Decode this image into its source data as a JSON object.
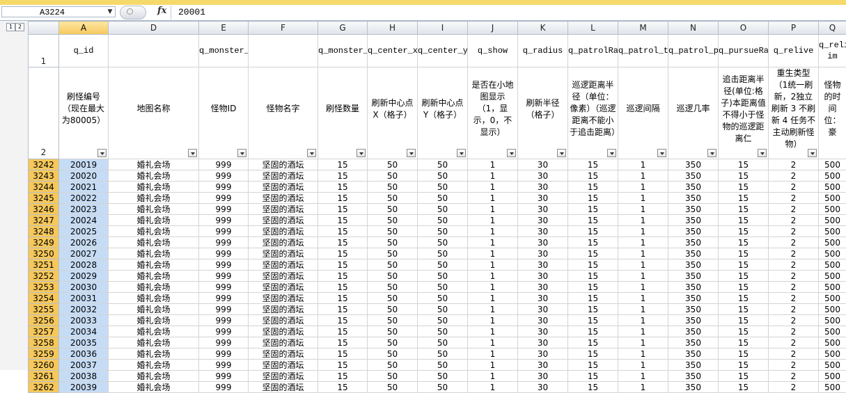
{
  "formula_bar": {
    "name_box": "A3224",
    "fx_label": "fx",
    "value": "20001"
  },
  "outline_levels": [
    "1",
    "2"
  ],
  "columns": [
    {
      "letter": "A",
      "field": "q_id",
      "desc": "刷怪编号（现在最大为80005）"
    },
    {
      "letter": "D",
      "field": "",
      "desc": "地图名称"
    },
    {
      "letter": "E",
      "field": "q_monster_model",
      "desc": "怪物ID"
    },
    {
      "letter": "F",
      "field": "",
      "desc": "怪物名字"
    },
    {
      "letter": "G",
      "field": "q_monster_num",
      "desc": "刷怪数量"
    },
    {
      "letter": "H",
      "field": "q_center_x",
      "desc": "刷新中心点X（格子）"
    },
    {
      "letter": "I",
      "field": "q_center_y",
      "desc": "刷新中心点Y（格子）"
    },
    {
      "letter": "J",
      "field": "q_show",
      "desc": "是否在小地图显示（1，显示，0，不显示）"
    },
    {
      "letter": "K",
      "field": "q_radius",
      "desc": "刷新半径（格子）"
    },
    {
      "letter": "L",
      "field": "q_patrolRange",
      "desc": "巡逻距离半径（单位：像素）（巡逻距离不能小于追击距离）"
    },
    {
      "letter": "M",
      "field": "q_patrol_time",
      "desc": "巡逻间隔"
    },
    {
      "letter": "N",
      "field": "q_patrol_pro",
      "desc": "巡逻几率"
    },
    {
      "letter": "O",
      "field": "q_pursueRange",
      "desc": "追击距离半径(单位:格子)本距离值不得小于怪物的巡逻距离仁"
    },
    {
      "letter": "P",
      "field": "q_relive",
      "desc": "重生类型（1统一刷新，2独立刷新 3 不刷新 4 任务不主动刷新怪物）"
    },
    {
      "letter": "Q",
      "field": "q_reli im",
      "desc": "怪物的时间位：豪"
    }
  ],
  "row_labels": {
    "header1": "1",
    "header2": "2"
  },
  "rows": [
    {
      "num": "3242",
      "cells": [
        "20019",
        "婚礼会场",
        "999",
        "坚固的酒坛",
        "15",
        "50",
        "50",
        "1",
        "30",
        "15",
        "1",
        "350",
        "15",
        "2",
        "500"
      ]
    },
    {
      "num": "3243",
      "cells": [
        "20020",
        "婚礼会场",
        "999",
        "坚固的酒坛",
        "15",
        "50",
        "50",
        "1",
        "30",
        "15",
        "1",
        "350",
        "15",
        "2",
        "500"
      ]
    },
    {
      "num": "3244",
      "cells": [
        "20021",
        "婚礼会场",
        "999",
        "坚固的酒坛",
        "15",
        "50",
        "50",
        "1",
        "30",
        "15",
        "1",
        "350",
        "15",
        "2",
        "500"
      ]
    },
    {
      "num": "3245",
      "cells": [
        "20022",
        "婚礼会场",
        "999",
        "坚固的酒坛",
        "15",
        "50",
        "50",
        "1",
        "30",
        "15",
        "1",
        "350",
        "15",
        "2",
        "500"
      ]
    },
    {
      "num": "3246",
      "cells": [
        "20023",
        "婚礼会场",
        "999",
        "坚固的酒坛",
        "15",
        "50",
        "50",
        "1",
        "30",
        "15",
        "1",
        "350",
        "15",
        "2",
        "500"
      ]
    },
    {
      "num": "3247",
      "cells": [
        "20024",
        "婚礼会场",
        "999",
        "坚固的酒坛",
        "15",
        "50",
        "50",
        "1",
        "30",
        "15",
        "1",
        "350",
        "15",
        "2",
        "500"
      ]
    },
    {
      "num": "3248",
      "cells": [
        "20025",
        "婚礼会场",
        "999",
        "坚固的酒坛",
        "15",
        "50",
        "50",
        "1",
        "30",
        "15",
        "1",
        "350",
        "15",
        "2",
        "500"
      ]
    },
    {
      "num": "3249",
      "cells": [
        "20026",
        "婚礼会场",
        "999",
        "坚固的酒坛",
        "15",
        "50",
        "50",
        "1",
        "30",
        "15",
        "1",
        "350",
        "15",
        "2",
        "500"
      ]
    },
    {
      "num": "3250",
      "cells": [
        "20027",
        "婚礼会场",
        "999",
        "坚固的酒坛",
        "15",
        "50",
        "50",
        "1",
        "30",
        "15",
        "1",
        "350",
        "15",
        "2",
        "500"
      ]
    },
    {
      "num": "3251",
      "cells": [
        "20028",
        "婚礼会场",
        "999",
        "坚固的酒坛",
        "15",
        "50",
        "50",
        "1",
        "30",
        "15",
        "1",
        "350",
        "15",
        "2",
        "500"
      ]
    },
    {
      "num": "3252",
      "cells": [
        "20029",
        "婚礼会场",
        "999",
        "坚固的酒坛",
        "15",
        "50",
        "50",
        "1",
        "30",
        "15",
        "1",
        "350",
        "15",
        "2",
        "500"
      ]
    },
    {
      "num": "3253",
      "cells": [
        "20030",
        "婚礼会场",
        "999",
        "坚固的酒坛",
        "15",
        "50",
        "50",
        "1",
        "30",
        "15",
        "1",
        "350",
        "15",
        "2",
        "500"
      ]
    },
    {
      "num": "3254",
      "cells": [
        "20031",
        "婚礼会场",
        "999",
        "坚固的酒坛",
        "15",
        "50",
        "50",
        "1",
        "30",
        "15",
        "1",
        "350",
        "15",
        "2",
        "500"
      ]
    },
    {
      "num": "3255",
      "cells": [
        "20032",
        "婚礼会场",
        "999",
        "坚固的酒坛",
        "15",
        "50",
        "50",
        "1",
        "30",
        "15",
        "1",
        "350",
        "15",
        "2",
        "500"
      ]
    },
    {
      "num": "3256",
      "cells": [
        "20033",
        "婚礼会场",
        "999",
        "坚固的酒坛",
        "15",
        "50",
        "50",
        "1",
        "30",
        "15",
        "1",
        "350",
        "15",
        "2",
        "500"
      ]
    },
    {
      "num": "3257",
      "cells": [
        "20034",
        "婚礼会场",
        "999",
        "坚固的酒坛",
        "15",
        "50",
        "50",
        "1",
        "30",
        "15",
        "1",
        "350",
        "15",
        "2",
        "500"
      ]
    },
    {
      "num": "3258",
      "cells": [
        "20035",
        "婚礼会场",
        "999",
        "坚固的酒坛",
        "15",
        "50",
        "50",
        "1",
        "30",
        "15",
        "1",
        "350",
        "15",
        "2",
        "500"
      ]
    },
    {
      "num": "3259",
      "cells": [
        "20036",
        "婚礼会场",
        "999",
        "坚固的酒坛",
        "15",
        "50",
        "50",
        "1",
        "30",
        "15",
        "1",
        "350",
        "15",
        "2",
        "500"
      ]
    },
    {
      "num": "3260",
      "cells": [
        "20037",
        "婚礼会场",
        "999",
        "坚固的酒坛",
        "15",
        "50",
        "50",
        "1",
        "30",
        "15",
        "1",
        "350",
        "15",
        "2",
        "500"
      ]
    },
    {
      "num": "3261",
      "cells": [
        "20038",
        "婚礼会场",
        "999",
        "坚固的酒坛",
        "15",
        "50",
        "50",
        "1",
        "30",
        "15",
        "1",
        "350",
        "15",
        "2",
        "500"
      ]
    },
    {
      "num": "3262",
      "cells": [
        "20039",
        "婚礼会场",
        "999",
        "坚固的酒坛",
        "15",
        "50",
        "50",
        "1",
        "30",
        "15",
        "1",
        "350",
        "15",
        "2",
        "500"
      ]
    }
  ],
  "colors": {
    "selected_header": "#f6c85b",
    "selected_cell": "#c6dcf5",
    "ribbon_accent": "#f5d96b"
  }
}
